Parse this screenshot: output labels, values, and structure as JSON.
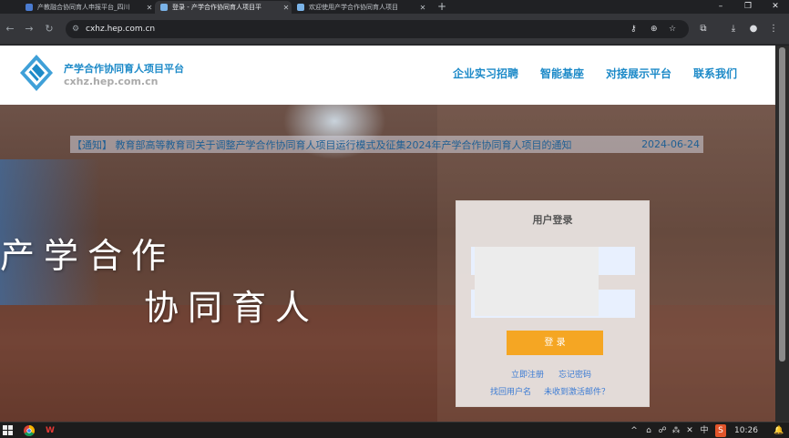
{
  "tabs": [
    {
      "title": "产教融合协同育人申报平台_四川",
      "active": false,
      "favicon_color": "#4a7bd0"
    },
    {
      "title": "登录 - 产学合作协同育人项目平",
      "active": true,
      "favicon_color": "#7ab3e8"
    },
    {
      "title": "欢迎使用产学合作协同育人项目",
      "active": false,
      "favicon_color": "#7ab3e8"
    }
  ],
  "browser": {
    "url": "cxhz.hep.com.cn",
    "new_tab": "+",
    "min": "–",
    "max": "❐",
    "close": "✕"
  },
  "site": {
    "title": "产学合作协同育人项目平台",
    "url_text": "cxhz.hep.com.cn",
    "nav": [
      "企业实习招聘",
      "智能基座",
      "对接展示平台",
      "联系我们"
    ],
    "accent": "#1d8ac8"
  },
  "notice": {
    "text": "【通知】 教育部高等教育司关于调整产学合作协同育人项目运行模式及征集2024年产学合作协同育人项目的通知",
    "date": "2024-06-24"
  },
  "slogan": {
    "line1": "产学合作",
    "line2": "协同育人"
  },
  "login": {
    "title": "用户登录",
    "button": "登 录",
    "links": [
      "立即注册",
      "忘记密码",
      "找回用户名",
      "未收到激活邮件？"
    ],
    "button_color": "#f5a623"
  },
  "taskbar": {
    "time": "10:26",
    "ime": "中",
    "tray": [
      "^",
      "⌂",
      "☍",
      "⁂",
      "✕",
      "中",
      "S",
      "🔔"
    ]
  }
}
